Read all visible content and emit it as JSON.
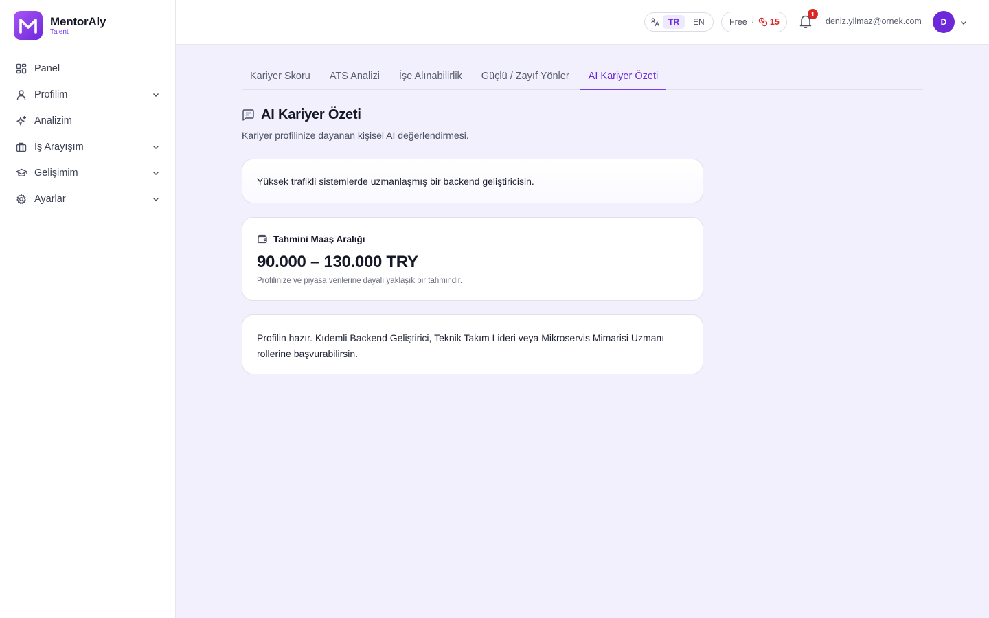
{
  "brand": {
    "name": "MentorAly",
    "subtitle": "Talent"
  },
  "sidebar": {
    "items": [
      {
        "label": "Panel",
        "icon": "grid-icon",
        "has_submenu": false
      },
      {
        "label": "Profilim",
        "icon": "user-icon",
        "has_submenu": true
      },
      {
        "label": "Analizim",
        "icon": "sparkles-icon",
        "has_submenu": false
      },
      {
        "label": "İş Arayışım",
        "icon": "briefcase-icon",
        "has_submenu": true
      },
      {
        "label": "Gelişimim",
        "icon": "graduation-cap-icon",
        "has_submenu": true
      },
      {
        "label": "Ayarlar",
        "icon": "settings-icon",
        "has_submenu": true
      }
    ]
  },
  "header": {
    "languages": {
      "active": "TR",
      "other": "EN"
    },
    "plan": {
      "name": "Free",
      "separator": "·",
      "credits": "15"
    },
    "notifications": {
      "count": "1"
    },
    "user_email": "deniz.yilmaz@ornek.com",
    "avatar_initial": "D"
  },
  "tabs": [
    {
      "label": "Kariyer Skoru",
      "active": false
    },
    {
      "label": "ATS Analizi",
      "active": false
    },
    {
      "label": "İşe Alınabilirlik",
      "active": false
    },
    {
      "label": "Güçlü / Zayıf Yönler",
      "active": false
    },
    {
      "label": "AI Kariyer Özeti",
      "active": true
    }
  ],
  "section": {
    "title": "AI Kariyer Özeti",
    "subtitle": "Kariyer profilinize dayanan kişisel AI değerlendirmesi."
  },
  "summary_card": {
    "text": "Yüksek trafikli sistemlerde uzmanlaşmış bir backend geliştiricisin."
  },
  "salary_card": {
    "title": "Tahmini Maaş Aralığı",
    "amount": "90.000 – 130.000 TRY",
    "note": "Profilinize ve piyasa verilerine dayalı yaklaşık bir tahmindir."
  },
  "roles_card": {
    "text": "Profilin hazır. Kıdemli Backend Geliştirici, Teknik Takım Lideri veya Mikroservis Mimarisi Uzmanı rollerine başvurabilirsin."
  },
  "colors": {
    "accent": "#6d28d9",
    "accent_light": "#ede9fe",
    "background": "#f1f0fc",
    "danger": "#dc2626"
  }
}
